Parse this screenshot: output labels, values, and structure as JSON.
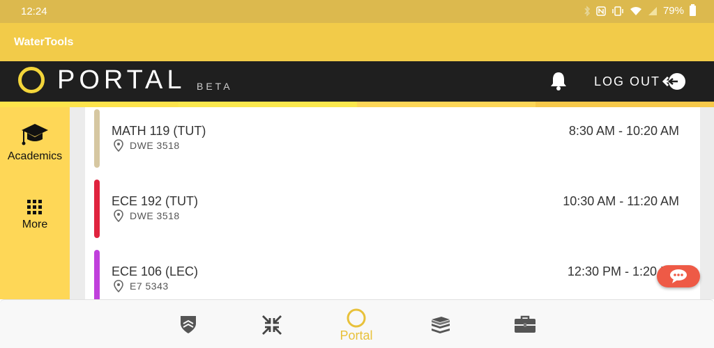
{
  "status_bar": {
    "time": "12:24",
    "battery": "79%"
  },
  "app_bar": {
    "title": "WaterTools"
  },
  "portal_header": {
    "logo_text": "PORTAL",
    "beta_label": "BETA",
    "logout_label": "LOG OUT"
  },
  "colors": {
    "accent_yellow": "#f2cb49",
    "dark_header": "#1f1f1f",
    "sidebar_yellow": "#fed757",
    "chat_red": "#ee5a46"
  },
  "stripes": [
    "#f3d53a",
    "#f3d53a",
    "#fed757",
    "#f7c94a"
  ],
  "sidebar": {
    "items": [
      {
        "label": "Academics",
        "icon": "graduation-cap-icon"
      },
      {
        "label": "More",
        "icon": "grid-icon"
      }
    ]
  },
  "schedule": [
    {
      "course": "MATH 119 (TUT)",
      "location": "DWE 3518",
      "time": "8:30 AM - 10:20 AM",
      "color": "#d6c7a1"
    },
    {
      "course": "ECE 192 (TUT)",
      "location": "DWE 3518",
      "time": "10:30 AM - 11:20 AM",
      "color": "#e0233e"
    },
    {
      "course": "ECE 106 (LEC)",
      "location": "E7 5343",
      "time": "12:30 PM - 1:20 PM",
      "color": "#c040dc"
    }
  ],
  "bottom_nav": {
    "items": [
      {
        "icon": "shield-icon",
        "label": ""
      },
      {
        "icon": "collapse-arrows-icon",
        "label": ""
      },
      {
        "icon": "portal-ring-icon",
        "label": "Portal"
      },
      {
        "icon": "books-icon",
        "label": ""
      },
      {
        "icon": "briefcase-icon",
        "label": ""
      }
    ]
  }
}
